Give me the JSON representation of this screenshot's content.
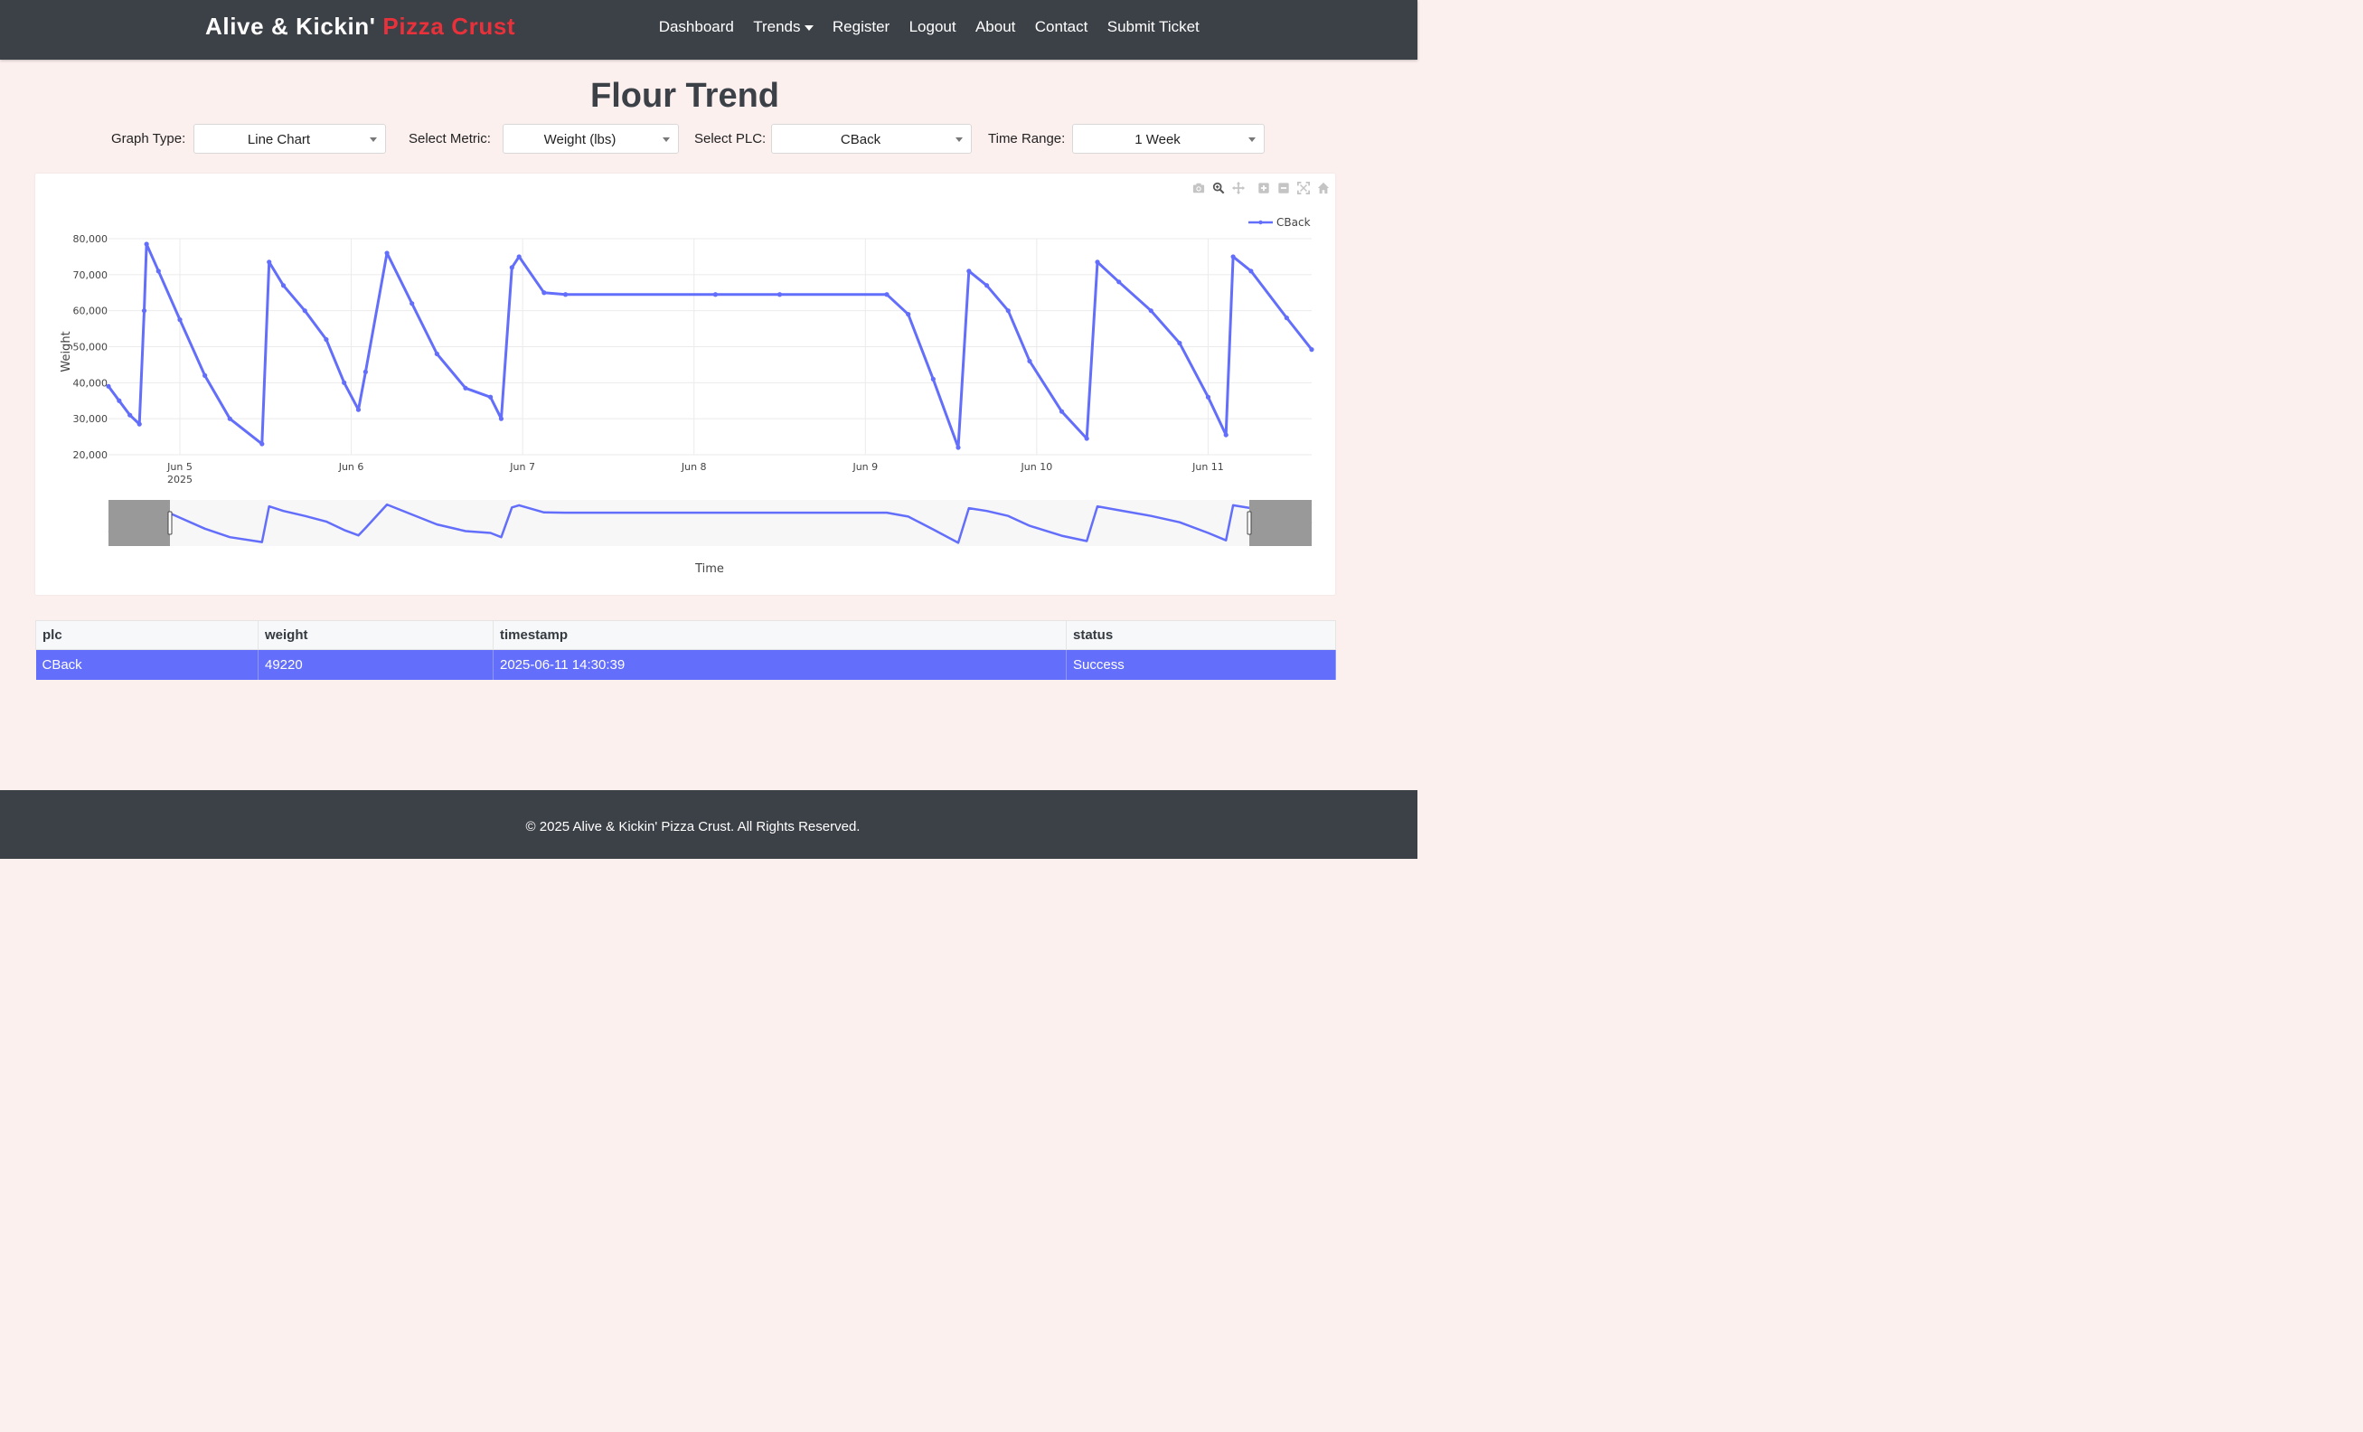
{
  "brand": {
    "main": "Alive & Kickin'",
    "accent": "Pizza Crust"
  },
  "nav": {
    "dashboard": "Dashboard",
    "trends": "Trends",
    "register": "Register",
    "logout": "Logout",
    "about": "About",
    "contact": "Contact",
    "submit_ticket": "Submit Ticket"
  },
  "page_title": "Flour Trend",
  "controls": {
    "graph_type": {
      "label": "Graph Type:",
      "value": "Line Chart"
    },
    "metric": {
      "label": "Select Metric:",
      "value": "Weight (lbs)"
    },
    "plc": {
      "label": "Select PLC:",
      "value": "CBack"
    },
    "time_range": {
      "label": "Time Range:",
      "value": "1 Week"
    }
  },
  "modebar_icons": [
    "camera-icon",
    "zoom-icon",
    "pan-icon",
    "zoom-in-icon",
    "zoom-out-icon",
    "autoscale-icon",
    "reset-axes-icon"
  ],
  "colors": {
    "navbar": "#3c4047",
    "brand_accent": "#e8313a",
    "series": "#636efa",
    "page_background": "#fcf0ef"
  },
  "chart_data": {
    "type": "line",
    "xlabel": "Time",
    "ylabel": "Weight",
    "ylim": [
      20000,
      80000
    ],
    "yticks": [
      20000,
      30000,
      40000,
      50000,
      60000,
      70000,
      80000
    ],
    "ytick_labels": [
      "20,000",
      "30,000",
      "40,000",
      "50,000",
      "60,000",
      "70,000",
      "80,000"
    ],
    "xlim": [
      "2025-06-04 14:00",
      "2025-06-11 14:30"
    ],
    "xticks": [
      "2025-06-05",
      "2025-06-06",
      "2025-06-07",
      "2025-06-08",
      "2025-06-09",
      "2025-06-10",
      "2025-06-11"
    ],
    "xtick_labels": [
      "Jun 5",
      "Jun 6",
      "Jun 7",
      "Jun 8",
      "Jun 9",
      "Jun 10",
      "Jun 11"
    ],
    "xtick_sublabel": "2025",
    "legend": {
      "position": "top-right",
      "entries": [
        "CBack"
      ]
    },
    "grid": true,
    "rangeslider": true,
    "series": [
      {
        "name": "CBack",
        "color": "#636efa",
        "points": [
          [
            "2025-06-04 14:00",
            39000
          ],
          [
            "2025-06-04 15:30",
            35000
          ],
          [
            "2025-06-04 17:00",
            31000
          ],
          [
            "2025-06-04 18:20",
            28500
          ],
          [
            "2025-06-04 19:00",
            60000
          ],
          [
            "2025-06-04 19:20",
            78500
          ],
          [
            "2025-06-04 21:00",
            71000
          ],
          [
            "2025-06-05 00:00",
            57500
          ],
          [
            "2025-06-05 03:30",
            42000
          ],
          [
            "2025-06-05 07:00",
            30000
          ],
          [
            "2025-06-05 11:30",
            23000
          ],
          [
            "2025-06-05 12:30",
            73500
          ],
          [
            "2025-06-05 14:30",
            67000
          ],
          [
            "2025-06-05 17:30",
            60000
          ],
          [
            "2025-06-05 20:30",
            52000
          ],
          [
            "2025-06-05 23:00",
            40000
          ],
          [
            "2025-06-06 01:00",
            32500
          ],
          [
            "2025-06-06 02:00",
            43000
          ],
          [
            "2025-06-06 05:00",
            76000
          ],
          [
            "2025-06-06 08:30",
            62000
          ],
          [
            "2025-06-06 12:00",
            48000
          ],
          [
            "2025-06-06 16:00",
            38500
          ],
          [
            "2025-06-06 19:30",
            36000
          ],
          [
            "2025-06-06 21:00",
            30000
          ],
          [
            "2025-06-06 22:30",
            72000
          ],
          [
            "2025-06-06 23:30",
            75000
          ],
          [
            "2025-06-07 03:00",
            65000
          ],
          [
            "2025-06-07 06:00",
            64500
          ],
          [
            "2025-06-08 03:00",
            64500
          ],
          [
            "2025-06-08 12:00",
            64500
          ],
          [
            "2025-06-09 03:00",
            64500
          ],
          [
            "2025-06-09 06:00",
            59000
          ],
          [
            "2025-06-09 09:30",
            41000
          ],
          [
            "2025-06-09 13:00",
            22000
          ],
          [
            "2025-06-09 14:30",
            71000
          ],
          [
            "2025-06-09 17:00",
            67000
          ],
          [
            "2025-06-09 20:00",
            60000
          ],
          [
            "2025-06-09 23:00",
            46000
          ],
          [
            "2025-06-10 03:30",
            32000
          ],
          [
            "2025-06-10 07:00",
            24500
          ],
          [
            "2025-06-10 08:30",
            73500
          ],
          [
            "2025-06-10 11:30",
            68000
          ],
          [
            "2025-06-10 16:00",
            60000
          ],
          [
            "2025-06-10 20:00",
            51000
          ],
          [
            "2025-06-11 00:00",
            36000
          ],
          [
            "2025-06-11 02:30",
            25500
          ],
          [
            "2025-06-11 03:30",
            75000
          ],
          [
            "2025-06-11 06:00",
            71000
          ],
          [
            "2025-06-11 11:00",
            58000
          ],
          [
            "2025-06-11 14:30",
            49220
          ]
        ]
      }
    ]
  },
  "table": {
    "headers": [
      "plc",
      "weight",
      "timestamp",
      "status"
    ],
    "rows": [
      [
        "CBack",
        "49220",
        "2025-06-11 14:30:39",
        "Success"
      ]
    ]
  },
  "footer": {
    "text": "© 2025 Alive & Kickin' Pizza Crust. All Rights Reserved."
  }
}
